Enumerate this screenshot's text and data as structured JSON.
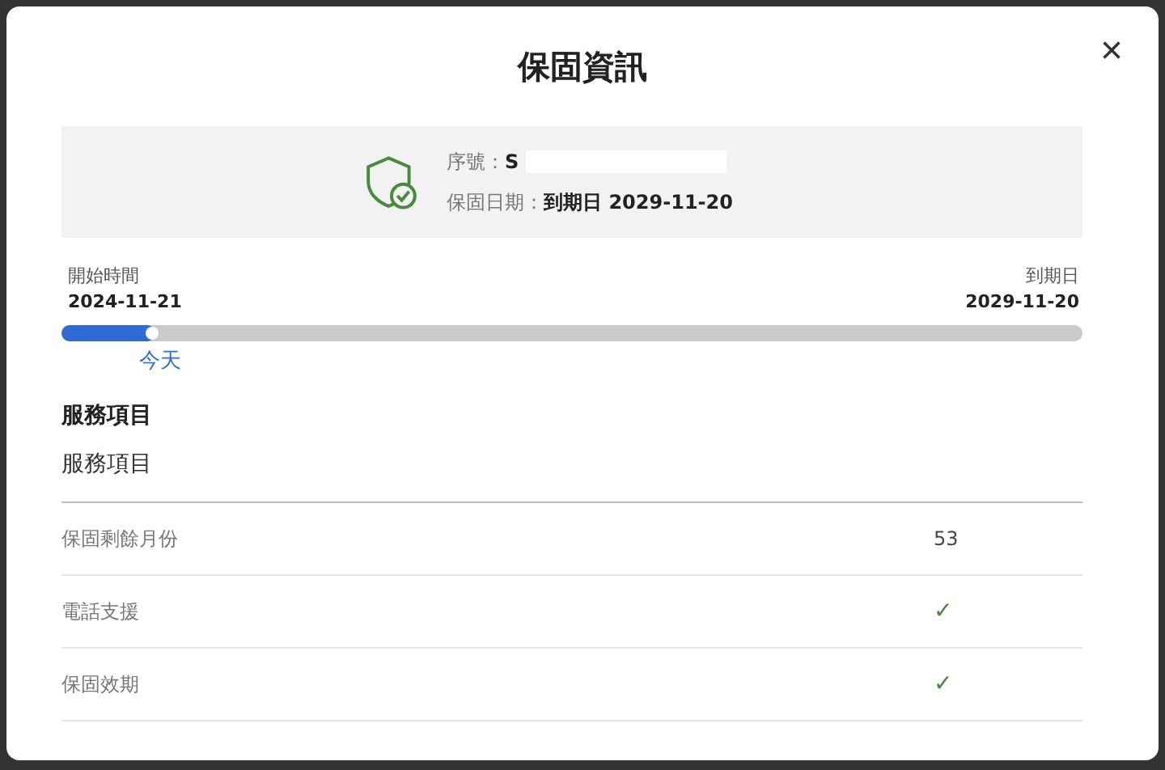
{
  "dialog": {
    "title": "保固資訊",
    "close": "×"
  },
  "info": {
    "serial_label": "序號：",
    "serial_value": "S",
    "date_label": "保固日期：",
    "date_value": "到期日 2029-11-20"
  },
  "timeline": {
    "start_label": "開始時間",
    "start_date": "2024-11-21",
    "end_label": "到期日",
    "end_date": "2029-11-20",
    "level": 0.092,
    "marker_label": "今天"
  },
  "services": {
    "heading": "服務項目",
    "column_1": "服務項目",
    "rows": [
      {
        "name": "保固剩餘月份",
        "value": "53",
        "kind": "text"
      },
      {
        "name": "電話支援",
        "value": "✓",
        "kind": "check"
      },
      {
        "name": "保固效期",
        "value": "✓",
        "kind": "check"
      }
    ]
  }
}
